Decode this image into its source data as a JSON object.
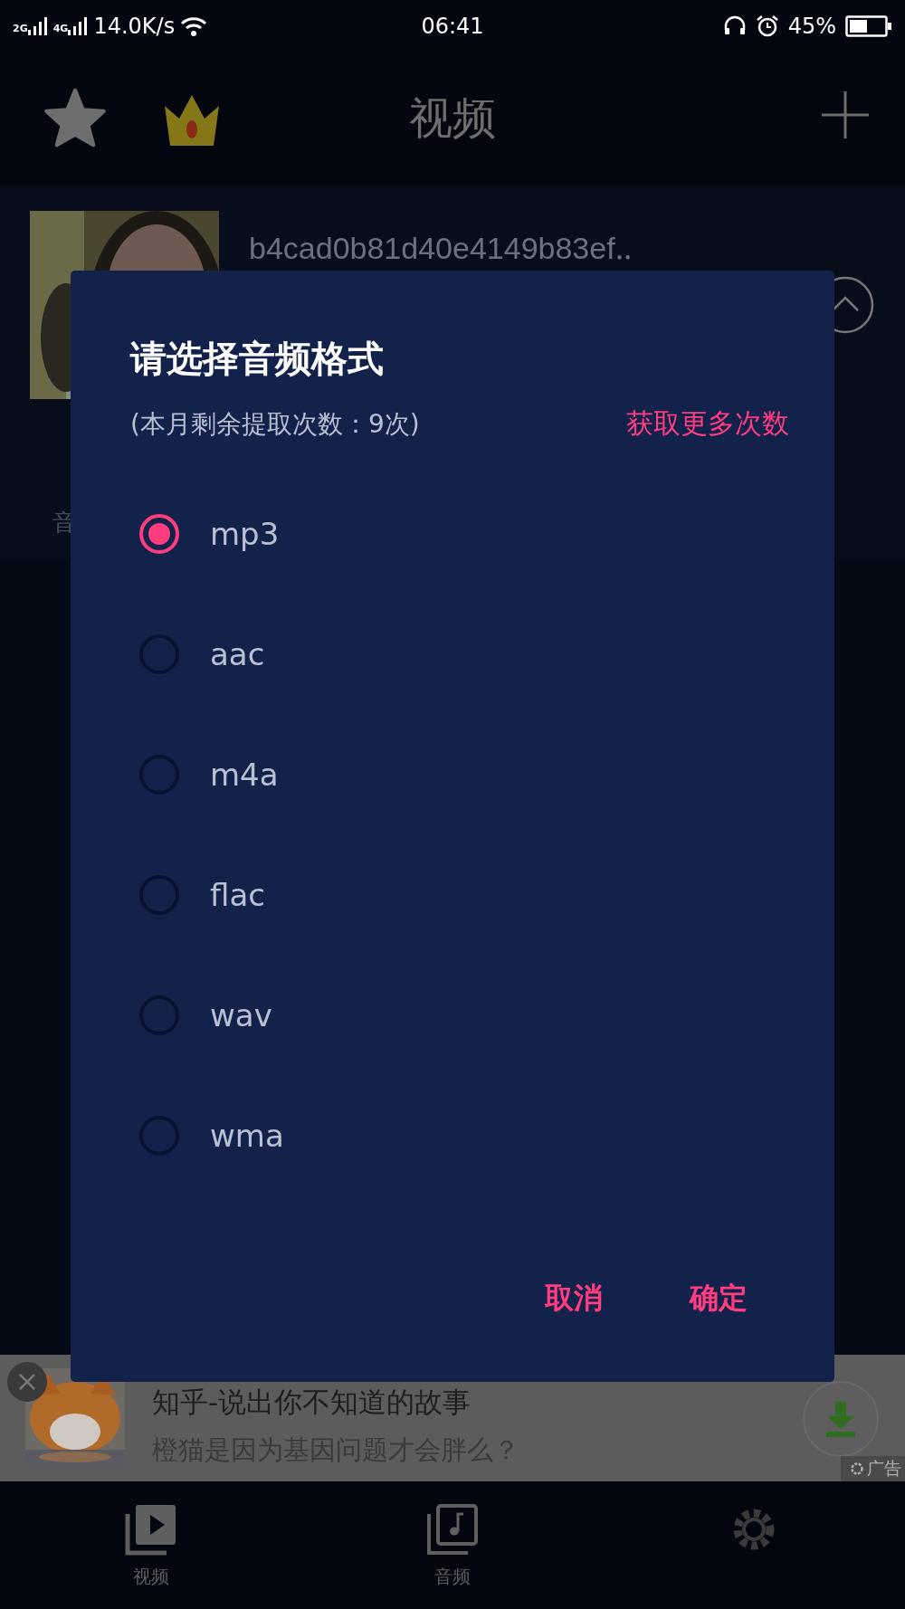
{
  "status_bar": {
    "network_1": "2G",
    "network_2": "4G",
    "speed": "14.0K/s",
    "time": "06:41",
    "battery": "45%"
  },
  "header": {
    "title": "视频"
  },
  "video": {
    "name": "b4cad0b81d40e4149b83ef‥",
    "section_label": "音"
  },
  "dialog": {
    "title": "请选择音频格式",
    "quota": "(本月剩余提取次数：9次)",
    "more_link": "获取更多次数",
    "options": [
      {
        "label": "mp3",
        "selected": true
      },
      {
        "label": "aac",
        "selected": false
      },
      {
        "label": "m4a",
        "selected": false
      },
      {
        "label": "flac",
        "selected": false
      },
      {
        "label": "wav",
        "selected": false
      },
      {
        "label": "wma",
        "selected": false
      }
    ],
    "buttons": [
      "取消",
      "确定"
    ]
  },
  "ad": {
    "title": "知乎-说出你不知道的故事",
    "subtitle": "橙猫是因为基因问题才会胖么？",
    "tag": "广告"
  },
  "nav": [
    {
      "kind": "video",
      "label": "视频"
    },
    {
      "kind": "audio",
      "label": "音频"
    },
    {
      "kind": "settings"
    }
  ]
}
